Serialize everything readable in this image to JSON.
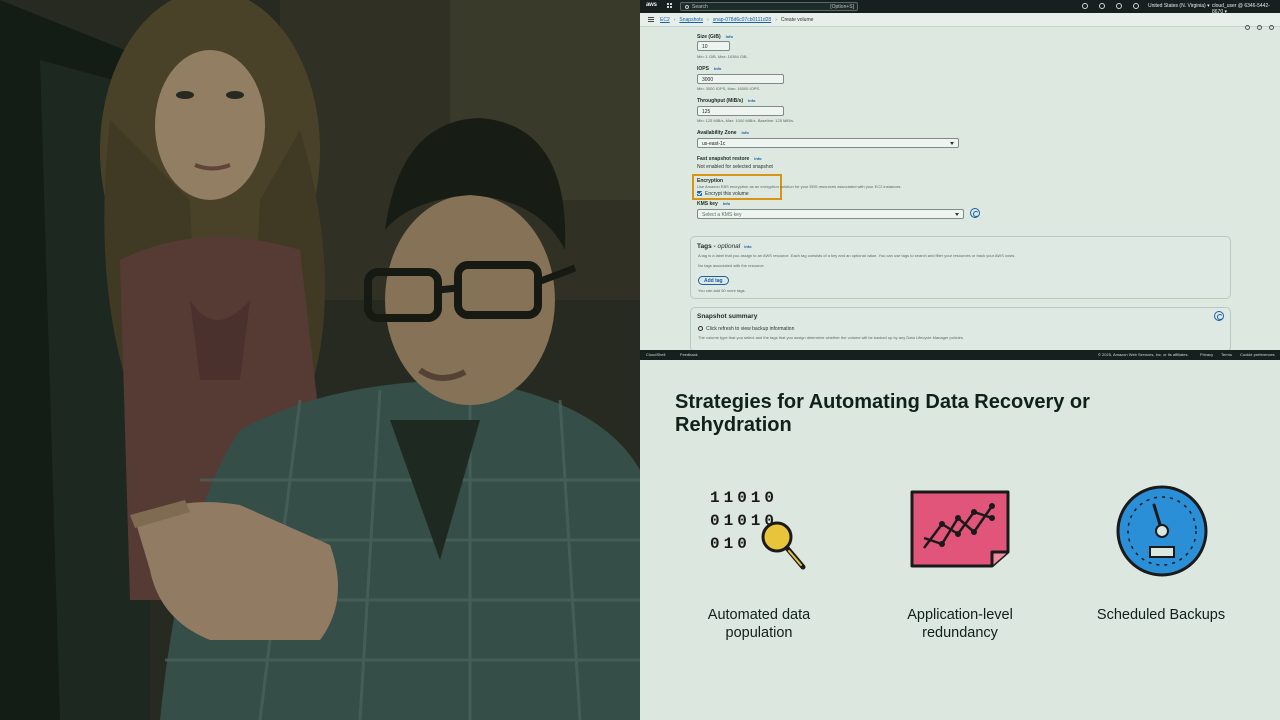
{
  "console": {
    "top_nav": {
      "logo": "aws",
      "search_placeholder": "Search",
      "search_shortcut": "[Option+S]",
      "region": "United States (N. Virginia) ▾",
      "account": "cloud_user @ 6346-5442-8670 ▾"
    },
    "breadcrumb": [
      "EC2",
      "Snapshots",
      "snap-078d6c07cb0111d28",
      "Create volume"
    ],
    "fields": {
      "size_label": "Size (GiB)",
      "size_value": "10",
      "size_hint": "Min: 1 GiB, Max: 16384 GiB.",
      "iops_label": "IOPS",
      "iops_value": "3000",
      "iops_hint": "Min: 3000 IOPS, Max: 16000 IOPS.",
      "throughput_label": "Throughput (MiB/s)",
      "throughput_value": "125",
      "throughput_hint": "Min: 125 MiB/s, Max: 1000 MiB/s. Baseline: 125 MiB/s.",
      "az_label": "Availability Zone",
      "az_value": "us-east-1c",
      "fsr_label": "Fast snapshot restore",
      "fsr_value": "Not enabled for selected snapshot",
      "encryption_label": "Encryption",
      "encryption_desc": "Use Amazon EBS encryption as an encryption solution for your EBS resources associated with your EC2 instances.",
      "encrypt_checkbox": "Encrypt this volume",
      "kms_label": "KMS key",
      "kms_placeholder": "Select a KMS key",
      "info": "Info"
    },
    "tags_panel": {
      "title": "Tags - ",
      "title_optional": "optional",
      "desc": "A tag is a label that you assign to an AWS resource. Each tag consists of a key and an optional value. You can use tags to search and filter your resources or track your AWS costs.",
      "empty": "No tags associated with the resource.",
      "add_button": "Add tag",
      "limit": "You can add 50 more tags."
    },
    "snapshot_panel": {
      "title": "Snapshot summary",
      "refresh": "Click refresh to view backup information",
      "desc": "The volume type that you select and the tags that you assign determine whether the volume will be backed up by any Data Lifecycle Manager policies."
    },
    "footer": {
      "cloudshell": "CloudShell",
      "feedback": "Feedback",
      "copyright": "© 2025, Amazon Web Services, Inc. or its affiliates.",
      "privacy": "Privacy",
      "terms": "Terms",
      "cookies": "Cookie preferences"
    }
  },
  "slide": {
    "title": "Strategies for Automating Data Recovery or Rehydration",
    "features": [
      {
        "label": "Automated data population",
        "icon": "binary-magnifier-icon"
      },
      {
        "label": "Application-level redundancy",
        "icon": "chart-sheet-icon"
      },
      {
        "label": "Scheduled Backups",
        "icon": "speed-gauge-icon"
      }
    ],
    "binary_rows": [
      "11010",
      "01010",
      "010"
    ]
  },
  "colors": {
    "aws_dark": "#16211f",
    "link_blue": "#1b5fa8",
    "highlight_orange": "#d99414",
    "slide_bg": "#dbe7df",
    "icon_pink": "#e2557a",
    "icon_blue": "#2a8fd6",
    "icon_yellow": "#e8c43a"
  }
}
